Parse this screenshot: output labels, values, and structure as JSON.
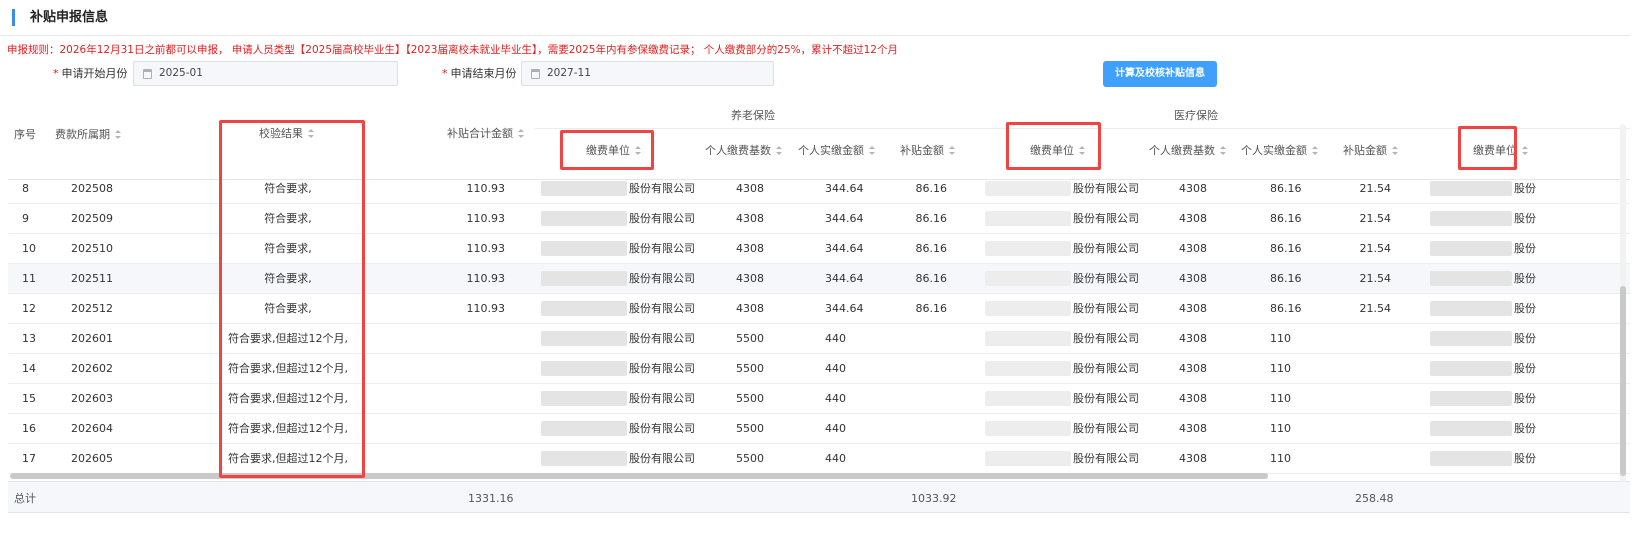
{
  "section": {
    "title": "补贴申报信息"
  },
  "rules_text": "申报规则：2026年12月31日之前都可以申报， 申请人员类型【2025届高校毕业生】【2023届离校未就业毕业生】，需要2025年内有参保缴费记录； 个人缴费部分的25%，累计不超过12个月",
  "form": {
    "start_label": "申请开始月份",
    "start_value": "2025-01",
    "end_label": "申请结束月份",
    "end_value": "2027-11",
    "required_mark": "*",
    "calc_button": "计算及校核补贴信息"
  },
  "table": {
    "groups": {
      "pension": "养老保险",
      "medical": "医疗保险"
    },
    "headers": {
      "seq": "序号",
      "period": "费款所属期",
      "check_result": "校验结果",
      "subsidy_total": "补贴合计金额",
      "unit": "缴费单位",
      "base": "个人缴费基数",
      "actual": "个人实缴金额",
      "subsidy": "补贴金额"
    },
    "rows": [
      {
        "seq": "8",
        "period": "202508",
        "result": "符合要求,",
        "total": "110.93",
        "p_unit": "股份有限公司",
        "p_base": "4308",
        "p_actual": "344.64",
        "p_sub": "86.16",
        "m_unit": "股份有限公司",
        "m_base": "4308",
        "m_actual": "86.16",
        "m_sub": "21.54",
        "u3": "股份"
      },
      {
        "seq": "9",
        "period": "202509",
        "result": "符合要求,",
        "total": "110.93",
        "p_unit": "股份有限公司",
        "p_base": "4308",
        "p_actual": "344.64",
        "p_sub": "86.16",
        "m_unit": "股份有限公司",
        "m_base": "4308",
        "m_actual": "86.16",
        "m_sub": "21.54",
        "u3": "股份"
      },
      {
        "seq": "10",
        "period": "202510",
        "result": "符合要求,",
        "total": "110.93",
        "p_unit": "股份有限公司",
        "p_base": "4308",
        "p_actual": "344.64",
        "p_sub": "86.16",
        "m_unit": "股份有限公司",
        "m_base": "4308",
        "m_actual": "86.16",
        "m_sub": "21.54",
        "u3": "股份"
      },
      {
        "seq": "11",
        "period": "202511",
        "result": "符合要求,",
        "total": "110.93",
        "p_unit": "股份有限公司",
        "p_base": "4308",
        "p_actual": "344.64",
        "p_sub": "86.16",
        "m_unit": "股份有限公司",
        "m_base": "4308",
        "m_actual": "86.16",
        "m_sub": "21.54",
        "u3": "股份"
      },
      {
        "seq": "12",
        "period": "202512",
        "result": "符合要求,",
        "total": "110.93",
        "p_unit": "股份有限公司",
        "p_base": "4308",
        "p_actual": "344.64",
        "p_sub": "86.16",
        "m_unit": "股份有限公司",
        "m_base": "4308",
        "m_actual": "86.16",
        "m_sub": "21.54",
        "u3": "股份"
      },
      {
        "seq": "13",
        "period": "202601",
        "result": "符合要求,但超过12个月,",
        "total": "",
        "p_unit": "股份有限公司",
        "p_base": "5500",
        "p_actual": "440",
        "p_sub": "",
        "m_unit": "股份有限公司",
        "m_base": "4308",
        "m_actual": "110",
        "m_sub": "",
        "u3": "股份"
      },
      {
        "seq": "14",
        "period": "202602",
        "result": "符合要求,但超过12个月,",
        "total": "",
        "p_unit": "股份有限公司",
        "p_base": "5500",
        "p_actual": "440",
        "p_sub": "",
        "m_unit": "股份有限公司",
        "m_base": "4308",
        "m_actual": "110",
        "m_sub": "",
        "u3": "股份"
      },
      {
        "seq": "15",
        "period": "202603",
        "result": "符合要求,但超过12个月,",
        "total": "",
        "p_unit": "股份有限公司",
        "p_base": "5500",
        "p_actual": "440",
        "p_sub": "",
        "m_unit": "股份有限公司",
        "m_base": "4308",
        "m_actual": "110",
        "m_sub": "",
        "u3": "股份"
      },
      {
        "seq": "16",
        "period": "202604",
        "result": "符合要求,但超过12个月,",
        "total": "",
        "p_unit": "股份有限公司",
        "p_base": "5500",
        "p_actual": "440",
        "p_sub": "",
        "m_unit": "股份有限公司",
        "m_base": "4308",
        "m_actual": "110",
        "m_sub": "",
        "u3": "股份"
      },
      {
        "seq": "17",
        "period": "202605",
        "result": "符合要求,但超过12个月,",
        "total": "",
        "p_unit": "股份有限公司",
        "p_base": "5500",
        "p_actual": "440",
        "p_sub": "",
        "m_unit": "股份有限公司",
        "m_base": "4308",
        "m_actual": "110",
        "m_sub": "",
        "u3": "股份"
      }
    ],
    "highlight_row": 3,
    "footer": {
      "label": "总计",
      "subsidy_total": "1331.16",
      "pension_subsidy": "1033.92",
      "medical_subsidy": "258.48"
    }
  }
}
